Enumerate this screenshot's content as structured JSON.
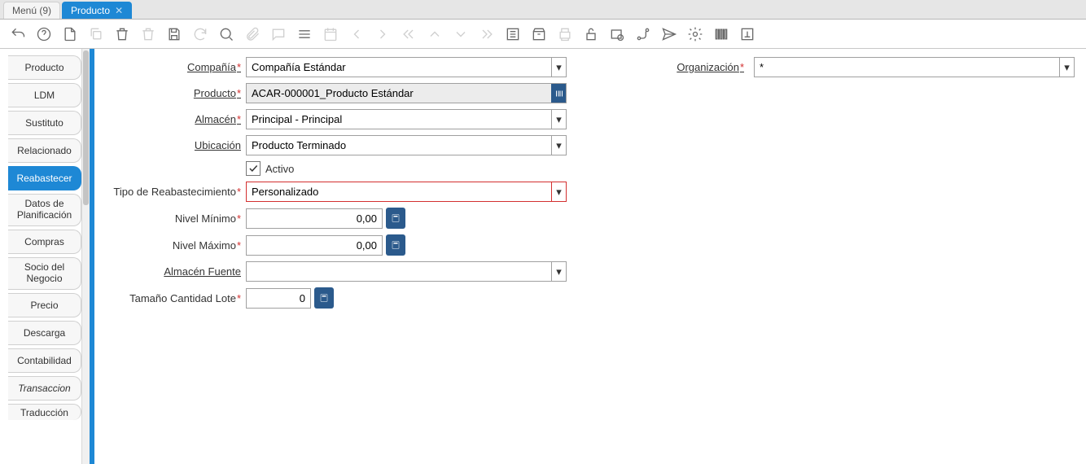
{
  "tabs": {
    "menu": "Menú (9)",
    "producto": "Producto"
  },
  "sidebar": {
    "items": [
      "Producto",
      "LDM",
      "Sustituto",
      "Relacionado",
      "Reabastecer",
      "Datos de",
      "Planificación",
      "Compras",
      "Socio del",
      "Negocio",
      "Precio",
      "Descarga",
      "Contabilidad",
      "Transaccion",
      "Traducción"
    ]
  },
  "form": {
    "compania": {
      "label": "Compañía",
      "value": "Compañía Estándar"
    },
    "organizacion": {
      "label": "Organización",
      "value": "*"
    },
    "producto": {
      "label": "Producto",
      "value": "ACAR-000001_Producto Estándar"
    },
    "almacen": {
      "label": "Almacén",
      "value": "Principal - Principal"
    },
    "ubicacion": {
      "label": "Ubicación",
      "value": "Producto Terminado"
    },
    "activo": {
      "label": "Activo"
    },
    "tipo": {
      "label": "Tipo de Reabastecimiento",
      "value": "Personalizado"
    },
    "nivelmin": {
      "label": "Nivel Mínimo",
      "value": "0,00"
    },
    "nivelmax": {
      "label": "Nivel Máximo",
      "value": "0,00"
    },
    "almfuente": {
      "label": "Almacén Fuente",
      "value": ""
    },
    "tamlote": {
      "label": "Tamaño Cantidad Lote",
      "value": "0"
    }
  }
}
